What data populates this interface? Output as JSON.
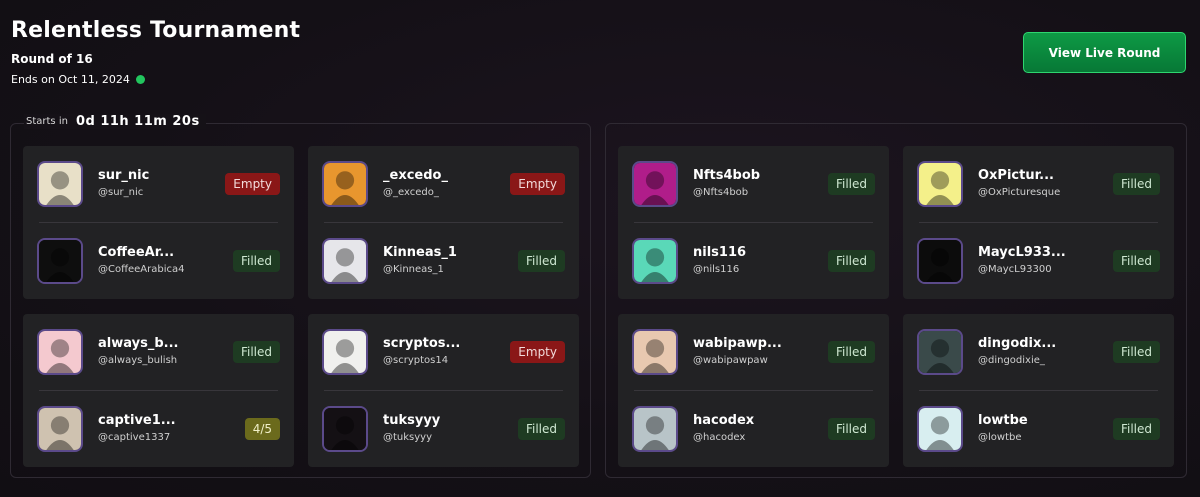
{
  "tournament": {
    "title": "Relentless Tournament",
    "round": "Round of 16",
    "ends": "Ends on Oct 11, 2024",
    "live_color": "#22c55e"
  },
  "actions": {
    "view_live_label": "View Live Round"
  },
  "countdown": {
    "label": "Starts in",
    "value": "0d 11h 11m 20s"
  },
  "matches": [
    {
      "slots": [
        {
          "name": "sur_nic",
          "handle": "@sur_nic",
          "status": "Empty",
          "avatar_bg": "#e8e0c8"
        },
        {
          "name": "CoffeeAr...",
          "handle": "@CoffeeArabica4",
          "status": "Filled",
          "avatar_bg": "#0e0e0e"
        }
      ]
    },
    {
      "slots": [
        {
          "name": "_excedo_",
          "handle": "@_excedo_",
          "status": "Empty",
          "avatar_bg": "#e8962e"
        },
        {
          "name": "Kinneas_1",
          "handle": "@Kinneas_1",
          "status": "Filled",
          "avatar_bg": "#e6e6ea"
        }
      ]
    },
    {
      "slots": [
        {
          "name": "always_b...",
          "handle": "@always_bulish",
          "status": "Filled",
          "avatar_bg": "#f4c9cf"
        },
        {
          "name": "captive1...",
          "handle": "@captive1337",
          "status": "4/5",
          "avatar_bg": "#cfc2b0"
        }
      ]
    },
    {
      "slots": [
        {
          "name": "scryptos...",
          "handle": "@scryptos14",
          "status": "Empty",
          "avatar_bg": "#f0f0ee"
        },
        {
          "name": "tuksyyy",
          "handle": "@tuksyyy",
          "status": "Filled",
          "avatar_bg": "#141014"
        }
      ]
    },
    {
      "slots": [
        {
          "name": "Nfts4bob",
          "handle": "@Nfts4bob",
          "status": "Filled",
          "avatar_bg": "#b01d8a"
        },
        {
          "name": "nils116",
          "handle": "@nils116",
          "status": "Filled",
          "avatar_bg": "#5ad8b8"
        }
      ]
    },
    {
      "slots": [
        {
          "name": "OxPictur...",
          "handle": "@OxPicturesque",
          "status": "Filled",
          "avatar_bg": "#f4f08a"
        },
        {
          "name": "MaycL933...",
          "handle": "@MaycL93300",
          "status": "Filled",
          "avatar_bg": "#0c0c0c"
        }
      ]
    },
    {
      "slots": [
        {
          "name": "wabipawp...",
          "handle": "@wabipawpaw",
          "status": "Filled",
          "avatar_bg": "#e8c8b0"
        },
        {
          "name": "hacodex",
          "handle": "@hacodex",
          "status": "Filled",
          "avatar_bg": "#b8c4c8"
        }
      ]
    },
    {
      "slots": [
        {
          "name": "dingodix...",
          "handle": "@dingodixie_",
          "status": "Filled",
          "avatar_bg": "#3a4a4a"
        },
        {
          "name": "lowtbe",
          "handle": "@lowtbe",
          "status": "Filled",
          "avatar_bg": "#d8eef0"
        }
      ]
    }
  ]
}
